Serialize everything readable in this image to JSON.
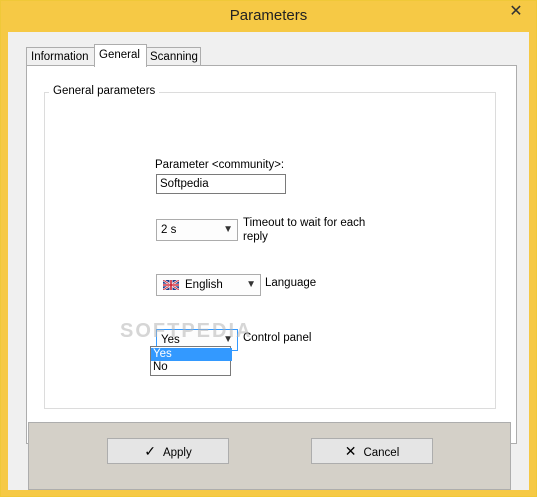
{
  "window": {
    "title": "Parameters"
  },
  "tabs": [
    {
      "label": "Information"
    },
    {
      "label": "General"
    },
    {
      "label": "Scanning"
    }
  ],
  "group": {
    "title": "General parameters"
  },
  "community": {
    "label": "Parameter <community>:",
    "value": "Softpedia"
  },
  "timeout": {
    "value": "2 s",
    "label_line1": "Timeout to wait for each",
    "label_line2": "reply"
  },
  "language": {
    "value": "English",
    "label": "Language",
    "flag_icon": "uk-flag-icon"
  },
  "control_panel": {
    "value": "Yes",
    "label": "Control panel",
    "options": [
      "Yes",
      "No"
    ]
  },
  "watermark": "SOFTPEDIA",
  "buttons": {
    "apply": "Apply",
    "cancel": "Cancel"
  },
  "colors": {
    "titlebar": "#f6c945",
    "selection": "#3399ff",
    "footer": "#d4d0c8"
  }
}
